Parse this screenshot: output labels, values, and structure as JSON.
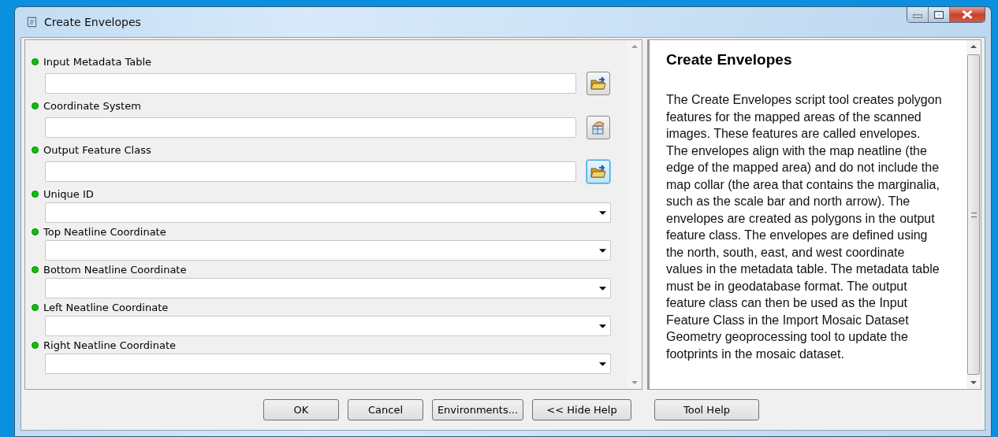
{
  "window": {
    "title": "Create Envelopes"
  },
  "parameters": [
    {
      "label": "Input Metadata Table",
      "kind": "browse",
      "highlighted": false
    },
    {
      "label": "Coordinate System",
      "kind": "picker",
      "highlighted": false
    },
    {
      "label": "Output Feature Class",
      "kind": "browse",
      "highlighted": true
    },
    {
      "label": "Unique ID",
      "kind": "dropdown",
      "highlighted": false
    },
    {
      "label": "Top Neatline Coordinate",
      "kind": "dropdown",
      "highlighted": false
    },
    {
      "label": "Bottom Neatline Coordinate",
      "kind": "dropdown",
      "highlighted": false
    },
    {
      "label": "Left Neatline Coordinate",
      "kind": "dropdown",
      "highlighted": false
    },
    {
      "label": "Right Neatline Coordinate",
      "kind": "dropdown",
      "highlighted": false
    }
  ],
  "help": {
    "title": "Create Envelopes",
    "body": "The Create Envelopes script tool creates polygon features for the mapped areas of the scanned images. These features are called envelopes. The envelopes align with the map neatline (the edge of the mapped area) and do not include the map collar (the area that contains the marginalia, such as the scale bar and north arrow). The envelopes are created as polygons in the output feature class. The envelopes are defined using the north, south, east, and west coordinate values in the metadata table. The metadata table must be in geodatabase format. The output feature class can then be used as the Input Feature Class in the Import Mosaic Dataset Geometry geoprocessing tool to update the footprints in the mosaic dataset."
  },
  "buttons": [
    "OK",
    "Cancel",
    "Environments...",
    "<< Hide Help",
    "Tool Help"
  ]
}
